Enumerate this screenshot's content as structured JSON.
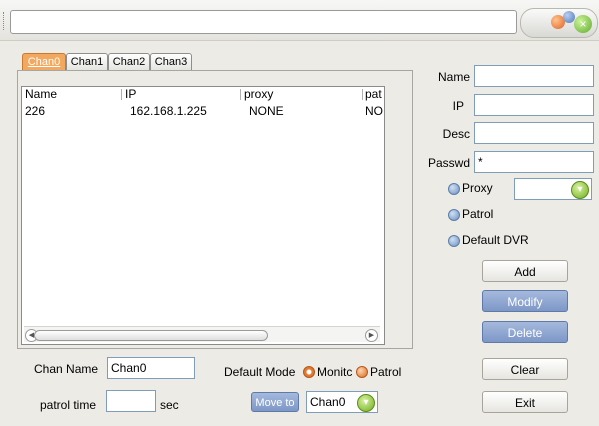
{
  "window": {
    "title": ""
  },
  "tabs": [
    "Chan0",
    "Chan1",
    "Chan2",
    "Chan3"
  ],
  "list": {
    "columns": [
      "Name",
      "IP",
      "proxy",
      "patr"
    ],
    "rows": [
      {
        "name": "226",
        "ip": "162.168.1.225",
        "proxy": "NONE",
        "patrol": "NO"
      }
    ]
  },
  "form": {
    "name_label": "Name",
    "name_value": "",
    "ip_label": "IP",
    "ip_value": "",
    "desc_label": "Desc",
    "desc_value": "",
    "passwd_label": "Passwd",
    "passwd_value": "*",
    "proxy_label": "Proxy",
    "proxy_value": "",
    "patrol_label": "Patrol",
    "default_dvr_label": "Default DVR"
  },
  "buttons": {
    "add": "Add",
    "modify": "Modify",
    "delete": "Delete",
    "clear": "Clear",
    "exit": "Exit",
    "move_to": "Move to"
  },
  "bottom": {
    "chan_name_label": "Chan Name",
    "chan_name_value": "Chan0",
    "patrol_time_label": "patrol time",
    "patrol_time_value": "",
    "sec_label": "sec",
    "default_mode_label": "Default Mode",
    "monitor_label": "Monitc",
    "patrol_label": "Patrol",
    "move_to_channel": "Chan0"
  },
  "colors": {
    "active_tab": "#f2a85f",
    "blue_button": "#7d97c7",
    "window_bg": "#ecebe6"
  }
}
